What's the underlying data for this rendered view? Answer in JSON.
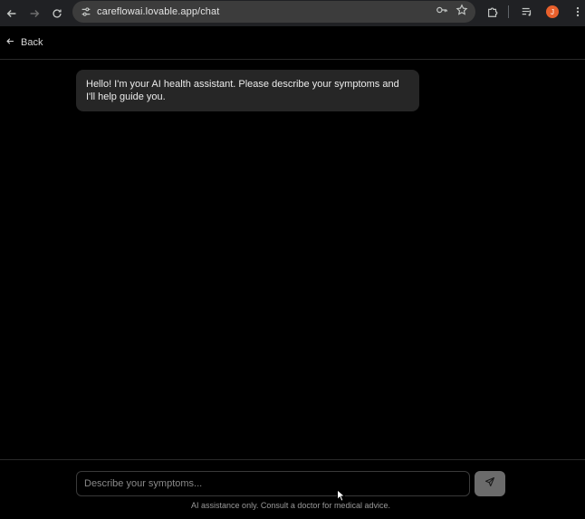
{
  "browser": {
    "url": "careflowai.lovable.app/chat",
    "profile_initial": "J"
  },
  "header": {
    "back_label": "Back"
  },
  "chat": {
    "messages": [
      {
        "role": "assistant",
        "text": "Hello! I'm your AI health assistant. Please describe your symptoms and I'll help guide you."
      }
    ]
  },
  "composer": {
    "placeholder": "Describe your symptoms...",
    "disclaimer": "AI assistance only. Consult a doctor for medical advice."
  },
  "colors": {
    "background": "#000000",
    "bubble": "#262626",
    "send_button": "#6b6b6b",
    "avatar": "#e8602c"
  }
}
